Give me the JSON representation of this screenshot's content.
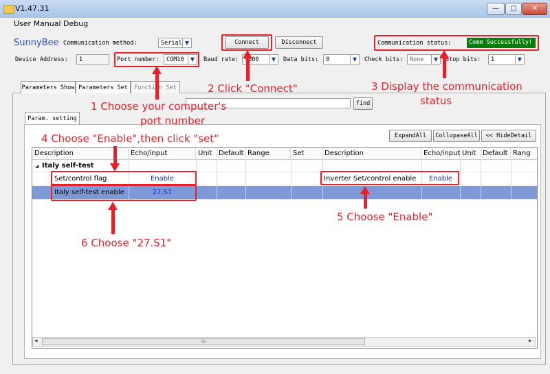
{
  "window": {
    "title": "V1.47.31",
    "min": "—",
    "max": "▢",
    "close": "✕"
  },
  "menu": {
    "items": [
      "User Manual",
      "Debug"
    ]
  },
  "app": {
    "brand": "SunnyBee"
  },
  "conn": {
    "method_label": "Communication method:",
    "method_value": "Serial",
    "connect": "Connect",
    "disconnect": "Disconnect",
    "status_label": "Communication status:",
    "status_value": "Comm Successfully!",
    "status_color": "#0c7a0c"
  },
  "params": {
    "device_label": "Device Address:",
    "device_value": "1",
    "port_label": "Port number:",
    "port_value": "COM10",
    "baud_label": "Baud rate:",
    "baud_value": "9600",
    "data_label": "Data bits:",
    "data_value": "8",
    "check_label": "Check bits:",
    "check_value": "None",
    "stop_label": "Stop bits:",
    "stop_value": "1"
  },
  "tabs": {
    "items": [
      "Parameters Show",
      "Parameters Set",
      "Function Set"
    ],
    "active_index": 1
  },
  "sub": {
    "tab": "Param. setting",
    "find": "find"
  },
  "grid_buttons": {
    "expand": "ExpandAll",
    "collapse": "CollopaseAll",
    "hide": "<< HideDetail"
  },
  "table": {
    "headers": [
      "Description",
      "Echo/input",
      "Unit",
      "Default",
      "Range",
      "Set",
      "Description",
      "Echo/input",
      "Unit",
      "Default",
      "Rang"
    ],
    "group": {
      "expander": "◢",
      "label": "Italy self-test"
    },
    "rows": [
      {
        "desc": "Set/control flag",
        "echo": "Enable",
        "desc2": "Inverter Set/control enable",
        "echo2": "Enable"
      },
      {
        "desc": "Italy self-test enable",
        "echo": "27.S1",
        "desc2": "",
        "echo2": ""
      }
    ]
  },
  "scroll": {
    "left": "◂",
    "right": "▸",
    "thumb": "III"
  },
  "annotations": {
    "a1a": "1 Choose your computer's",
    "a1b": "port number",
    "a2": "2 Click \"Connect\"",
    "a3a": "3 Display the communication",
    "a3b": "status",
    "a4": "4 Choose \"Enable\",then click \"set\"",
    "a5": "5 Choose \"Enable\"",
    "a6": "6 Choose \"27.S1\"",
    "color": "#e8202a"
  }
}
